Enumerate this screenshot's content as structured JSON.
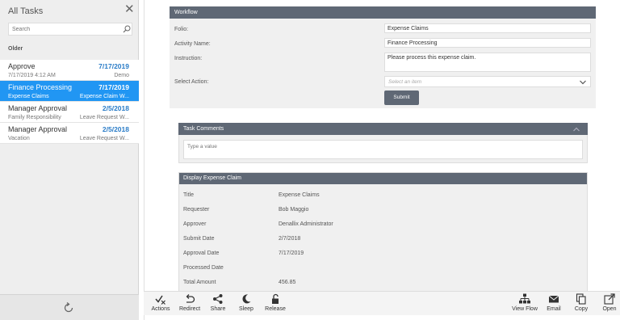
{
  "sidebar": {
    "title": "All Tasks",
    "search_placeholder": "Search",
    "section_label": "Older",
    "tasks": [
      {
        "title": "Approve",
        "date": "7/17/2019",
        "subtitle": "7/17/2019 4:12 AM",
        "meta": "Demo"
      },
      {
        "title": "Finance Processing",
        "date": "7/17/2019",
        "subtitle": "Expense Claims",
        "meta": "Expense Claim W..."
      },
      {
        "title": "Manager Approval",
        "date": "2/5/2018",
        "subtitle": "Family Responsibility",
        "meta": "Leave Request W..."
      },
      {
        "title": "Manager Approval",
        "date": "2/5/2018",
        "subtitle": "Vacation",
        "meta": "Leave Request W..."
      }
    ]
  },
  "workflow": {
    "header": "Workflow",
    "folio_label": "Folio:",
    "folio_value": "Expense Claims",
    "activity_label": "Activity Name:",
    "activity_value": "Finance Processing",
    "instruction_label": "Instruction:",
    "instruction_value": "Please process this expense claim.",
    "action_label": "Select Action:",
    "action_placeholder": "Select an item",
    "submit_label": "Submit"
  },
  "comments": {
    "header": "Task Comments",
    "placeholder": "Type a value"
  },
  "expense": {
    "header": "Display Expense Claim",
    "rows": [
      {
        "key": "Title",
        "value": "Expense Claims"
      },
      {
        "key": "Requester",
        "value": "Bob Maggio"
      },
      {
        "key": "Approver",
        "value": "Denallix Administrator"
      },
      {
        "key": "Submit Date",
        "value": "2/7/2018"
      },
      {
        "key": "Approval Date",
        "value": "7/17/2019"
      },
      {
        "key": "Processed Date",
        "value": ""
      },
      {
        "key": "Total Amount",
        "value": "456.85"
      }
    ]
  },
  "toolbar": {
    "actions": "Actions",
    "redirect": "Redirect",
    "share": "Share",
    "sleep": "Sleep",
    "release": "Release",
    "view_flow": "View Flow",
    "email": "Email",
    "copy": "Copy",
    "open": "Open"
  },
  "colors": {
    "accent": "#2196f3",
    "panel_header": "#5f6875",
    "date_blue": "#2a7cc7"
  }
}
